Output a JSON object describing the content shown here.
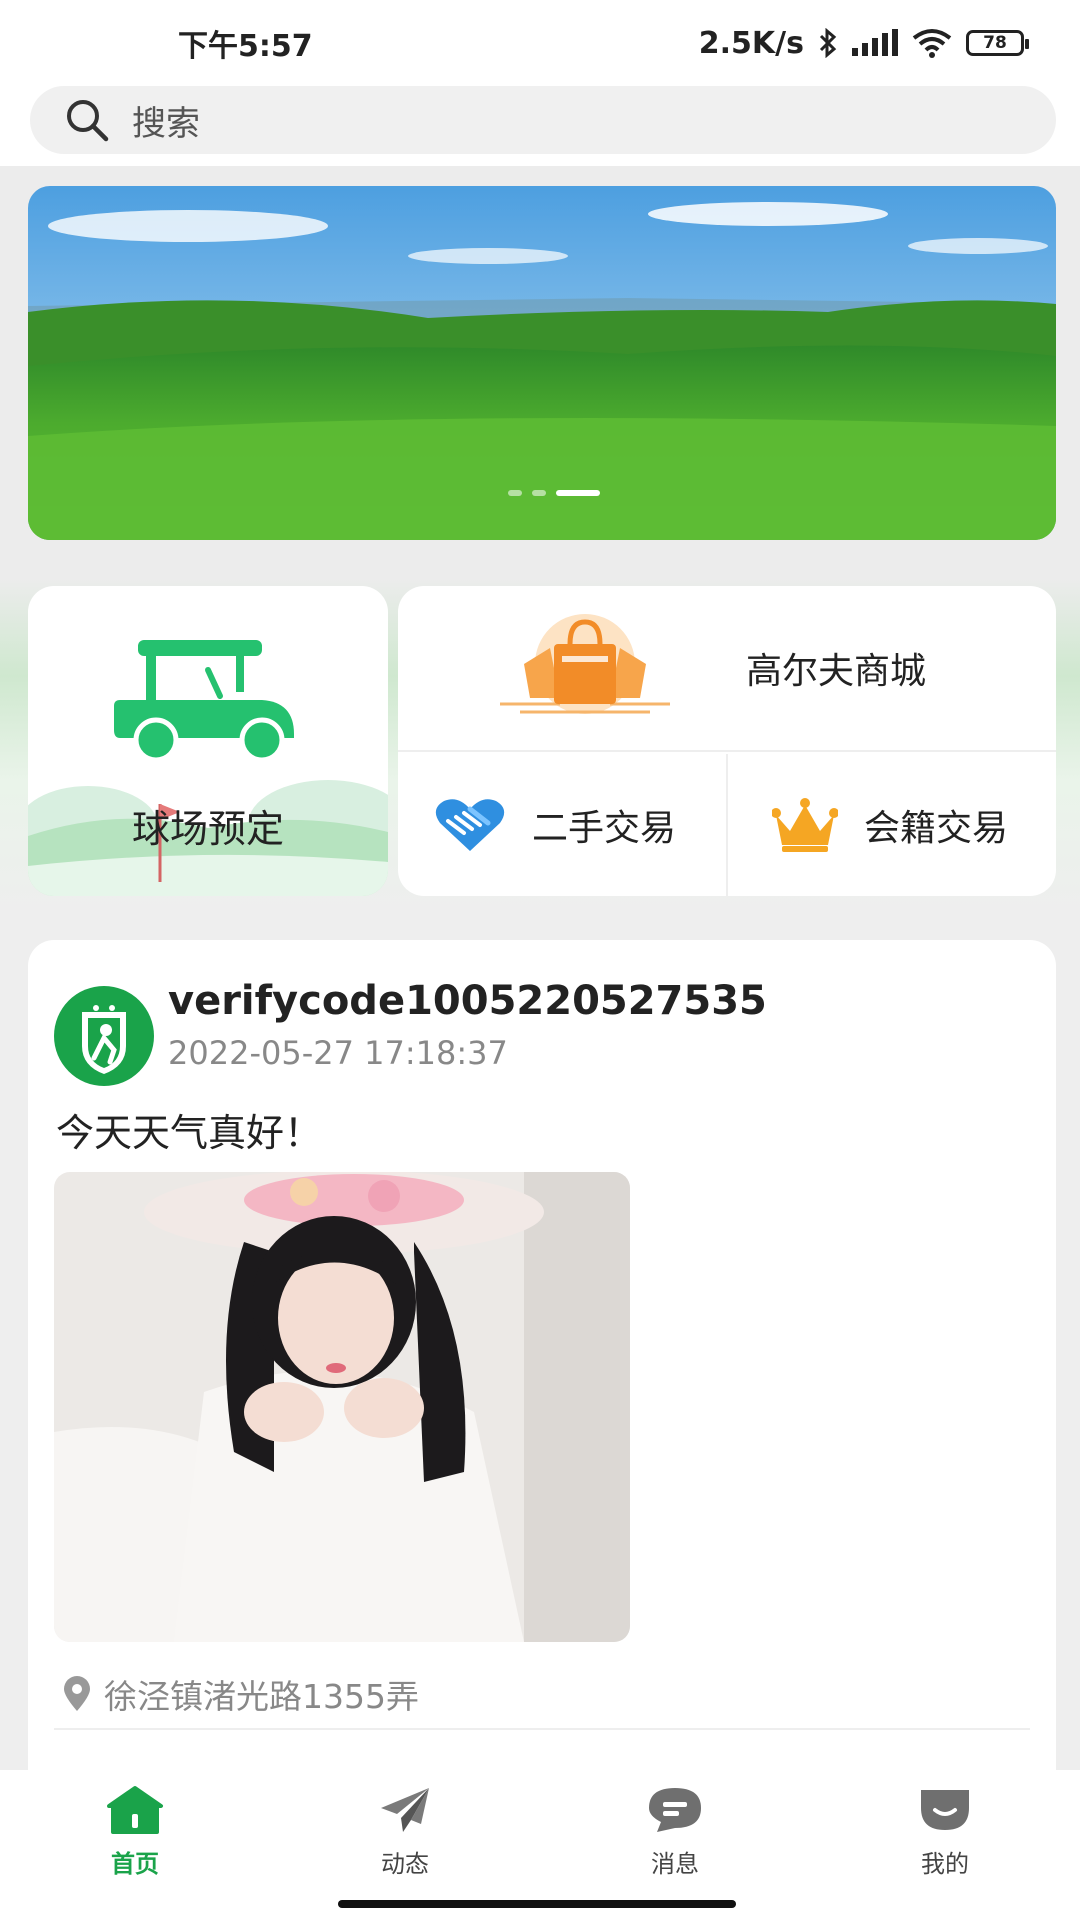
{
  "status_bar": {
    "time": "下午5:57",
    "network_speed": "2.5K/s",
    "battery": "78",
    "icons": [
      "bluetooth-icon",
      "signal-icon",
      "wifi-icon",
      "battery-icon"
    ]
  },
  "search": {
    "placeholder": "搜索",
    "icon": "search-icon"
  },
  "banner": {
    "page_count": 3,
    "active_page": 3
  },
  "quick_actions": {
    "court_booking": "球场预定",
    "golf_shop": "高尔夫商城",
    "secondhand": "二手交易",
    "membership": "会籍交易"
  },
  "post": {
    "username": "verifycode1005220527535",
    "timestamp": "2022-05-27 17:18:37",
    "content": "今天天气真好！",
    "location": "徐泾镇渚光路1355弄"
  },
  "bottom_nav": {
    "items": [
      {
        "label": "首页",
        "icon": "home-icon",
        "active": true
      },
      {
        "label": "动态",
        "icon": "paper-plane-icon",
        "active": false
      },
      {
        "label": "消息",
        "icon": "chat-icon",
        "active": false
      },
      {
        "label": "我的",
        "icon": "profile-icon",
        "active": false
      }
    ]
  },
  "colors": {
    "accent": "#1aa34a",
    "accent_light": "#25c16f",
    "gold": "#f5a623",
    "blue": "#2f8fe0",
    "orange": "#f39a3c"
  }
}
